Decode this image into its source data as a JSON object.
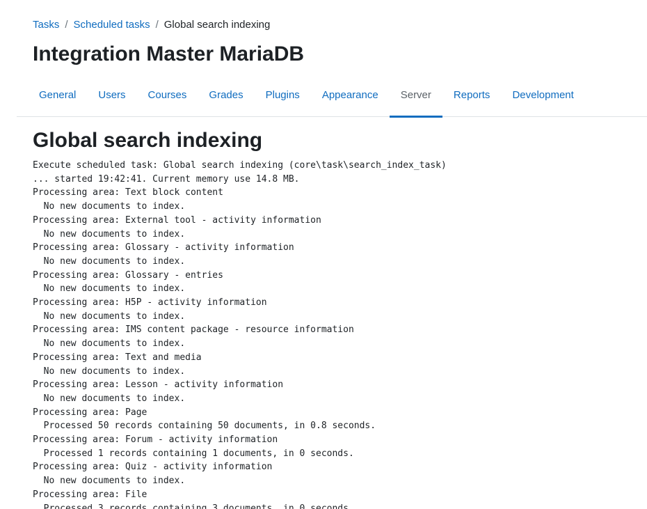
{
  "breadcrumb": {
    "items": [
      "Tasks",
      "Scheduled tasks"
    ],
    "separator": "/",
    "current": "Global search indexing"
  },
  "page_title": "Integration Master MariaDB",
  "tabs": [
    {
      "label": "General",
      "active": false
    },
    {
      "label": "Users",
      "active": false
    },
    {
      "label": "Courses",
      "active": false
    },
    {
      "label": "Grades",
      "active": false
    },
    {
      "label": "Plugins",
      "active": false
    },
    {
      "label": "Appearance",
      "active": false
    },
    {
      "label": "Server",
      "active": true
    },
    {
      "label": "Reports",
      "active": false
    },
    {
      "label": "Development",
      "active": false
    }
  ],
  "section_title": "Global search indexing",
  "log_lines": [
    "Execute scheduled task: Global search indexing (core\\task\\search_index_task)",
    "... started 19:42:41. Current memory use 14.8 MB.",
    "Processing area: Text block content",
    "  No new documents to index.",
    "Processing area: External tool - activity information",
    "  No new documents to index.",
    "Processing area: Glossary - activity information",
    "  No new documents to index.",
    "Processing area: Glossary - entries",
    "  No new documents to index.",
    "Processing area: H5P - activity information",
    "  No new documents to index.",
    "Processing area: IMS content package - resource information",
    "  No new documents to index.",
    "Processing area: Text and media",
    "  No new documents to index.",
    "Processing area: Lesson - activity information",
    "  No new documents to index.",
    "Processing area: Page",
    "  Processed 50 records containing 50 documents, in 0.8 seconds.",
    "Processing area: Forum - activity information",
    "  Processed 1 records containing 1 documents, in 0 seconds.",
    "Processing area: Quiz - activity information",
    "  No new documents to index.",
    "Processing area: File",
    "  Processed 3 records containing 3 documents, in 0 seconds."
  ],
  "colors": {
    "link": "#0f6cbf",
    "text": "#1d2125",
    "muted": "#6a737b",
    "border": "#dee2e6"
  }
}
